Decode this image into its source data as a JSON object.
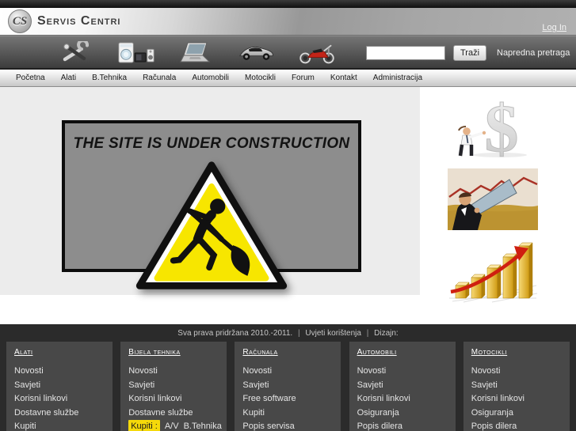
{
  "colors": {
    "accent_yellow": "#f7e600",
    "highlight_yellow": "#f5d90a",
    "footer_bg": "#2b2b2b",
    "footer_column_bg": "#484848",
    "construction_box_bg": "#8d8d8d"
  },
  "header": {
    "logo_monogram": "CS",
    "site_name": "Servis Centri",
    "login_label": "Log In"
  },
  "toolbar": {
    "icons": [
      "tools",
      "appliances",
      "computers",
      "cars",
      "motorcycles"
    ],
    "search_value": "",
    "search_button_label": "Traži",
    "advanced_search_label": "Napredna pretraga"
  },
  "nav": {
    "items": [
      "Početna",
      "Alati",
      "B.Tehnika",
      "Računala",
      "Automobili",
      "Motocikli",
      "Forum",
      "Kontakt",
      "Administracija"
    ]
  },
  "main": {
    "banner_title": "THE SITE IS UNDER CONSTRUCTION"
  },
  "sidebar_images": [
    {
      "name": "dollar-businessman"
    },
    {
      "name": "megaphone-announcement"
    },
    {
      "name": "golden-growth-chart"
    }
  ],
  "footer": {
    "copyright_text": "Sva prava pridržana 2010.-2011.",
    "separator": "|",
    "terms_label": "Uvjeti korištenja",
    "design_label": "Dizajn:",
    "columns": [
      {
        "title": "Alati",
        "links": [
          "Novosti",
          "Savjeti",
          "Korisni linkovi",
          "Dostavne službe",
          "Kupiti"
        ]
      },
      {
        "title": "Bijela tehnika",
        "links": [
          "Novosti",
          "Savjeti",
          "Korisni linkovi",
          "Dostavne službe"
        ],
        "buy_label": "Kupiti :",
        "buy_items": [
          "A/V",
          "B.Tehnika"
        ]
      },
      {
        "title": "Računala",
        "links": [
          "Novosti",
          "Savjeti",
          "Free software",
          "Kupiti",
          "Popis servisa"
        ]
      },
      {
        "title": "Automobili",
        "links": [
          "Novosti",
          "Savjeti",
          "Korisni linkovi",
          "Osiguranja",
          "Popis dilera"
        ]
      },
      {
        "title": "Motocikli",
        "links": [
          "Novosti",
          "Savjeti",
          "Korisni linkovi",
          "Osiguranja",
          "Popis dilera"
        ]
      }
    ]
  }
}
